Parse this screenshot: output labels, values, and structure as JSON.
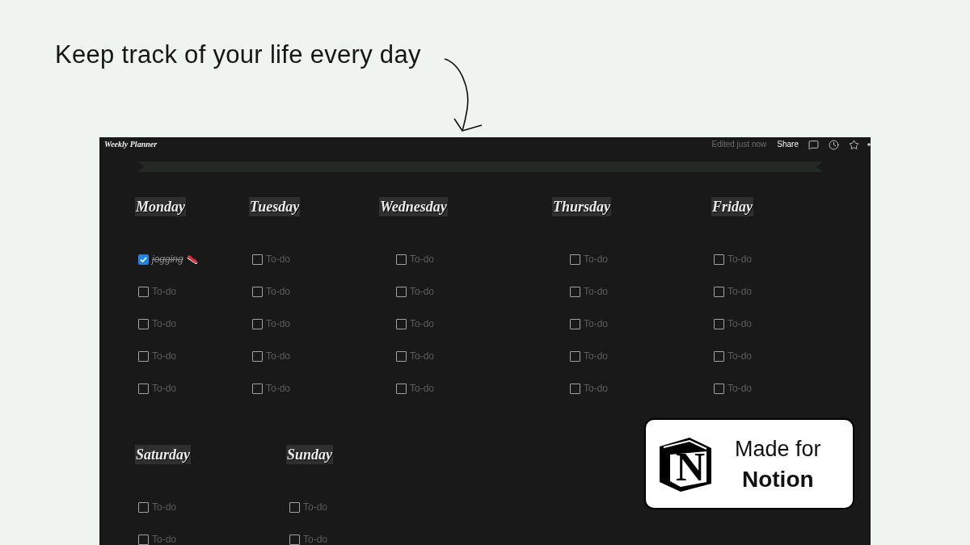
{
  "headline": "Keep track of your life every day",
  "window": {
    "title": "Weekly Planner",
    "status": "Edited just now",
    "share": "Share"
  },
  "days": [
    {
      "name": "Monday",
      "todos": [
        {
          "text": "jogging",
          "checked": true,
          "emoji": true
        },
        {
          "placeholder": "To-do",
          "checked": false
        },
        {
          "placeholder": "To-do",
          "checked": false
        },
        {
          "placeholder": "To-do",
          "checked": false
        },
        {
          "placeholder": "To-do",
          "checked": false
        }
      ]
    },
    {
      "name": "Tuesday",
      "todos": [
        {
          "placeholder": "To-do",
          "checked": false
        },
        {
          "placeholder": "To-do",
          "checked": false
        },
        {
          "placeholder": "To-do",
          "checked": false
        },
        {
          "placeholder": "To-do",
          "checked": false
        },
        {
          "placeholder": "To-do",
          "checked": false
        }
      ]
    },
    {
      "name": "Wednesday",
      "todos": [
        {
          "placeholder": "To-do",
          "checked": false
        },
        {
          "placeholder": "To-do",
          "checked": false
        },
        {
          "placeholder": "To-do",
          "checked": false
        },
        {
          "placeholder": "To-do",
          "checked": false
        },
        {
          "placeholder": "To-do",
          "checked": false
        }
      ]
    },
    {
      "name": "Thursday",
      "todos": [
        {
          "placeholder": "To-do",
          "checked": false
        },
        {
          "placeholder": "To-do",
          "checked": false
        },
        {
          "placeholder": "To-do",
          "checked": false
        },
        {
          "placeholder": "To-do",
          "checked": false
        },
        {
          "placeholder": "To-do",
          "checked": false
        }
      ]
    },
    {
      "name": "Friday",
      "todos": [
        {
          "placeholder": "To-do",
          "checked": false
        },
        {
          "placeholder": "To-do",
          "checked": false
        },
        {
          "placeholder": "To-do",
          "checked": false
        },
        {
          "placeholder": "To-do",
          "checked": false
        },
        {
          "placeholder": "To-do",
          "checked": false
        }
      ]
    },
    {
      "name": "Saturday",
      "todos": [
        {
          "placeholder": "To-do",
          "checked": false
        },
        {
          "placeholder": "To-do",
          "checked": false
        }
      ]
    },
    {
      "name": "Sunday",
      "todos": [
        {
          "placeholder": "To-do",
          "checked": false
        },
        {
          "placeholder": "To-do",
          "checked": false
        }
      ]
    }
  ],
  "badge": {
    "logo_letter": "N",
    "line1": "Made for",
    "line2": "Notion"
  }
}
